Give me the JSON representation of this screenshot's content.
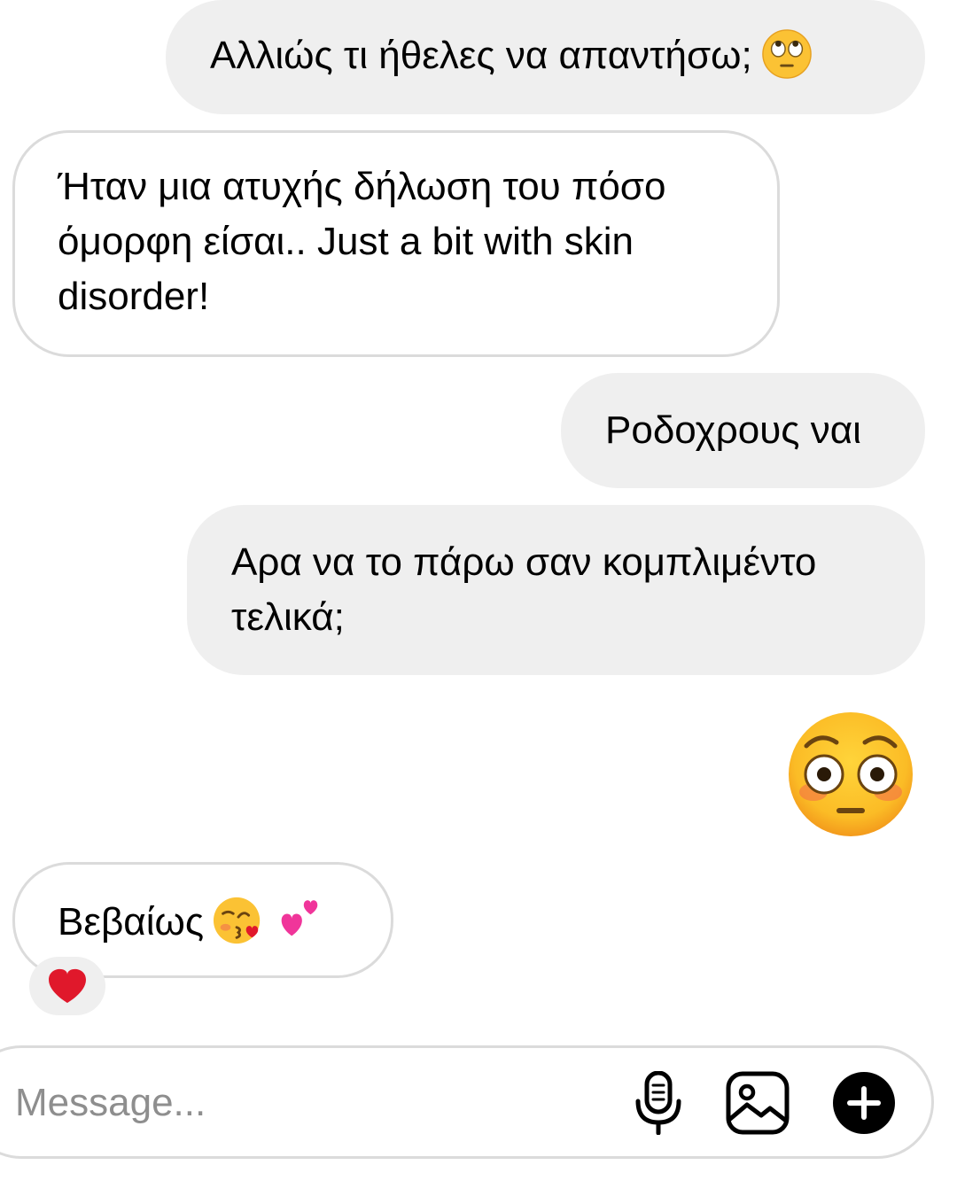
{
  "messages": [
    {
      "id": "msg-1",
      "direction": "sent",
      "text": "Αλλιώς τι ήθελες να απαντήσω;",
      "emoji": "face-with-rolling-eyes"
    },
    {
      "id": "msg-2",
      "direction": "received",
      "text": "Ήταν μια ατυχής δήλωση του πόσο όμορφη είσαι.. Just a bit with skin disorder!"
    },
    {
      "id": "msg-3",
      "direction": "sent",
      "text": "Ροδοχρους ναι"
    },
    {
      "id": "msg-4",
      "direction": "sent",
      "text": "Αρα να το πάρω σαν κομπλιμέντο τελικά;"
    },
    {
      "id": "msg-5",
      "direction": "sent",
      "emoji": "flushed-face"
    },
    {
      "id": "msg-6",
      "direction": "received",
      "text": "Βεβαίως",
      "emojis": [
        "face-blowing-a-kiss",
        "two-hearts"
      ],
      "reaction": "red-heart"
    }
  ],
  "composer": {
    "placeholder": "Message...",
    "value": "",
    "icons": [
      "microphone-icon",
      "gallery-icon",
      "plus-icon"
    ]
  },
  "colors": {
    "sent_bubble": "#efefef",
    "received_border": "#dbdbdb",
    "placeholder": "#8e8e8e",
    "emoji_yellow": "#fbc234",
    "heart_red": "#e0182b",
    "heart_pink": "#f0359a"
  }
}
